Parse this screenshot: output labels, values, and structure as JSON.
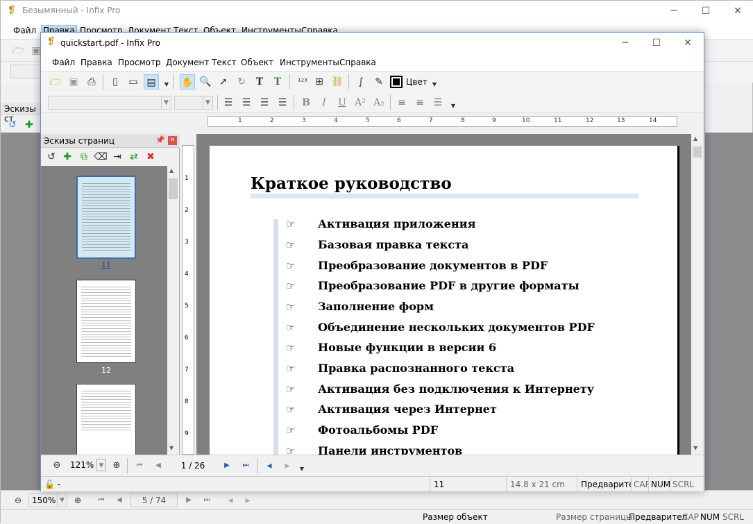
{
  "background_window": {
    "title": "Безымянный - Infix Pro",
    "menu": [
      "Файл",
      "Правка",
      "Просмотр",
      "Документ",
      "Текст",
      "Объект",
      "Инструменты",
      "Справка"
    ],
    "thumbs_title": "Эскизы ст",
    "zoom": "150%",
    "page": "5 / 74",
    "status": [
      "Размер объект",
      "Размер страницы",
      "Предварител",
      "CAP",
      "NUM",
      "SCRL"
    ]
  },
  "window": {
    "title": "quickstart.pdf - Infix Pro",
    "menu": [
      "Файл",
      "Правка",
      "Просмотр",
      "Документ",
      "Текст",
      "Объект",
      "Инструменты",
      "Справка"
    ],
    "color_label": "Цвет"
  },
  "thumbnails": {
    "title": "Эскизы страниц",
    "labels": [
      "11",
      "12"
    ]
  },
  "ruler": {
    "h": [
      "1",
      "2",
      "3",
      "4",
      "5",
      "6",
      "7",
      "8",
      "9",
      "10",
      "11",
      "12",
      "13",
      "14"
    ],
    "v": [
      "1",
      "2",
      "3",
      "4",
      "5",
      "6",
      "7",
      "8",
      "9"
    ]
  },
  "document": {
    "title": "Краткое руководство",
    "items": [
      "Активация приложения",
      "Базовая правка текста",
      "Преобразование документов в PDF",
      "Преобразование PDF в другие форматы",
      "Заполнение форм",
      "Объединение нескольких документов PDF",
      "Новые функции в версии 6",
      "Правка распознанного текста",
      "Активация без подключения к Интернету",
      "Активация через Интернет",
      "Фотоальбомы PDF",
      "Панели инструментов"
    ]
  },
  "nav": {
    "zoom": "121%",
    "page": "1 / 26"
  },
  "status": {
    "lock": "-",
    "page": "11",
    "size": "14.8 x 21 cm",
    "preview": "Предварител",
    "cap": "CAP",
    "num": "NUM",
    "scrl": "SCRL"
  }
}
